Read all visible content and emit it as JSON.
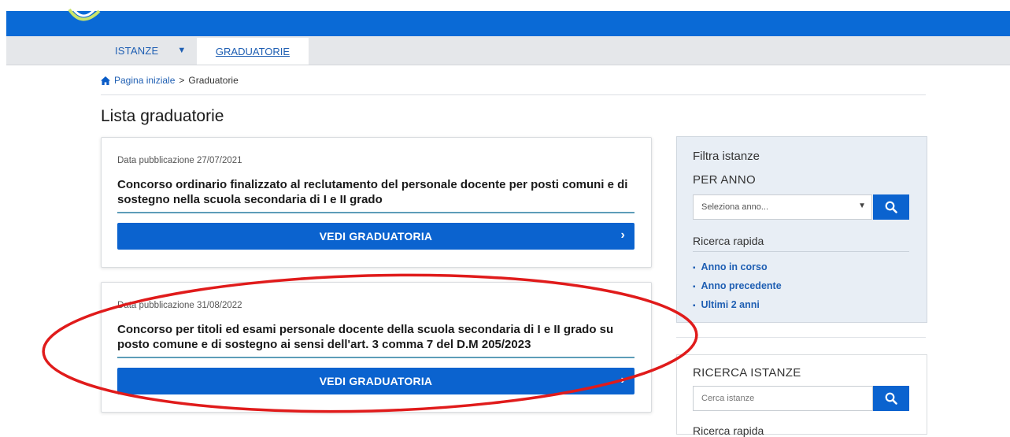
{
  "nav": {
    "istanze_label": "ISTANZE",
    "graduatorie_label": "GRADUATORIE"
  },
  "breadcrumb": {
    "home_label": "Pagina iniziale",
    "separator": ">",
    "current": "Graduatorie"
  },
  "page_title": "Lista graduatorie",
  "cards": [
    {
      "date": "Data pubblicazione 27/07/2021",
      "title": "Concorso ordinario finalizzato al reclutamento del personale docente per posti comuni e di sostegno nella scuola secondaria di I e II grado",
      "button_label": "VEDI GRADUATORIA"
    },
    {
      "date": "Data pubblicazione 31/08/2022",
      "title": "Concorso per titoli ed esami personale docente della scuola secondaria di I e II grado su posto comune e di sostegno ai sensi dell'art. 3 comma 7 del D.M 205/2023",
      "button_label": "VEDI GRADUATORIA"
    }
  ],
  "filter": {
    "heading": "Filtra istanze",
    "per_anno": "PER ANNO",
    "select_placeholder": "Seleziona anno...",
    "ricerca_rapida": "Ricerca rapida",
    "quick_links": [
      "Anno in corso",
      "Anno precedente",
      "Ultimi 2 anni"
    ]
  },
  "ricerca": {
    "heading": "RICERCA ISTANZE",
    "placeholder": "Cerca istanze",
    "cut_label": "Ricerca rapida"
  },
  "colors": {
    "brand_blue": "#0a6ad6",
    "button_blue": "#0b63cf",
    "link_blue": "#1f5fb3",
    "annotation_red": "#e01b1b"
  }
}
